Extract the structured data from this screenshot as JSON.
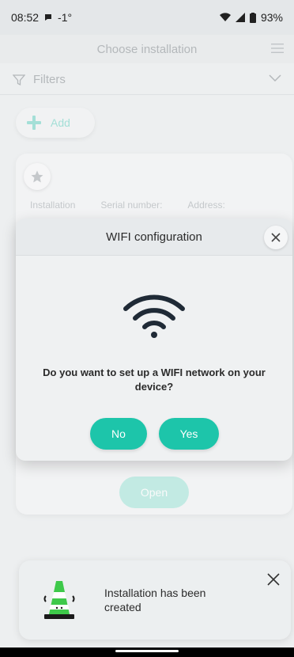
{
  "status_bar": {
    "time": "08:52",
    "temperature": "-1°",
    "battery": "93%"
  },
  "header": {
    "title": "Choose installation",
    "menu_icon": "hamburger-menu-icon"
  },
  "filters": {
    "label": "Filters"
  },
  "add_button": {
    "label": "Add"
  },
  "card": {
    "labels": [
      "Installation",
      "Serial number:",
      "Address:"
    ],
    "open_label": "Open"
  },
  "modal": {
    "title": "WIFI configuration",
    "question": "Do you want to set up a WIFI network on your device?",
    "no_label": "No",
    "yes_label": "Yes"
  },
  "toast": {
    "message": "Installation has been created"
  },
  "colors": {
    "accent": "#1dc5aa",
    "accent_light": "#a8e4dc",
    "background": "#f2f4f5"
  }
}
